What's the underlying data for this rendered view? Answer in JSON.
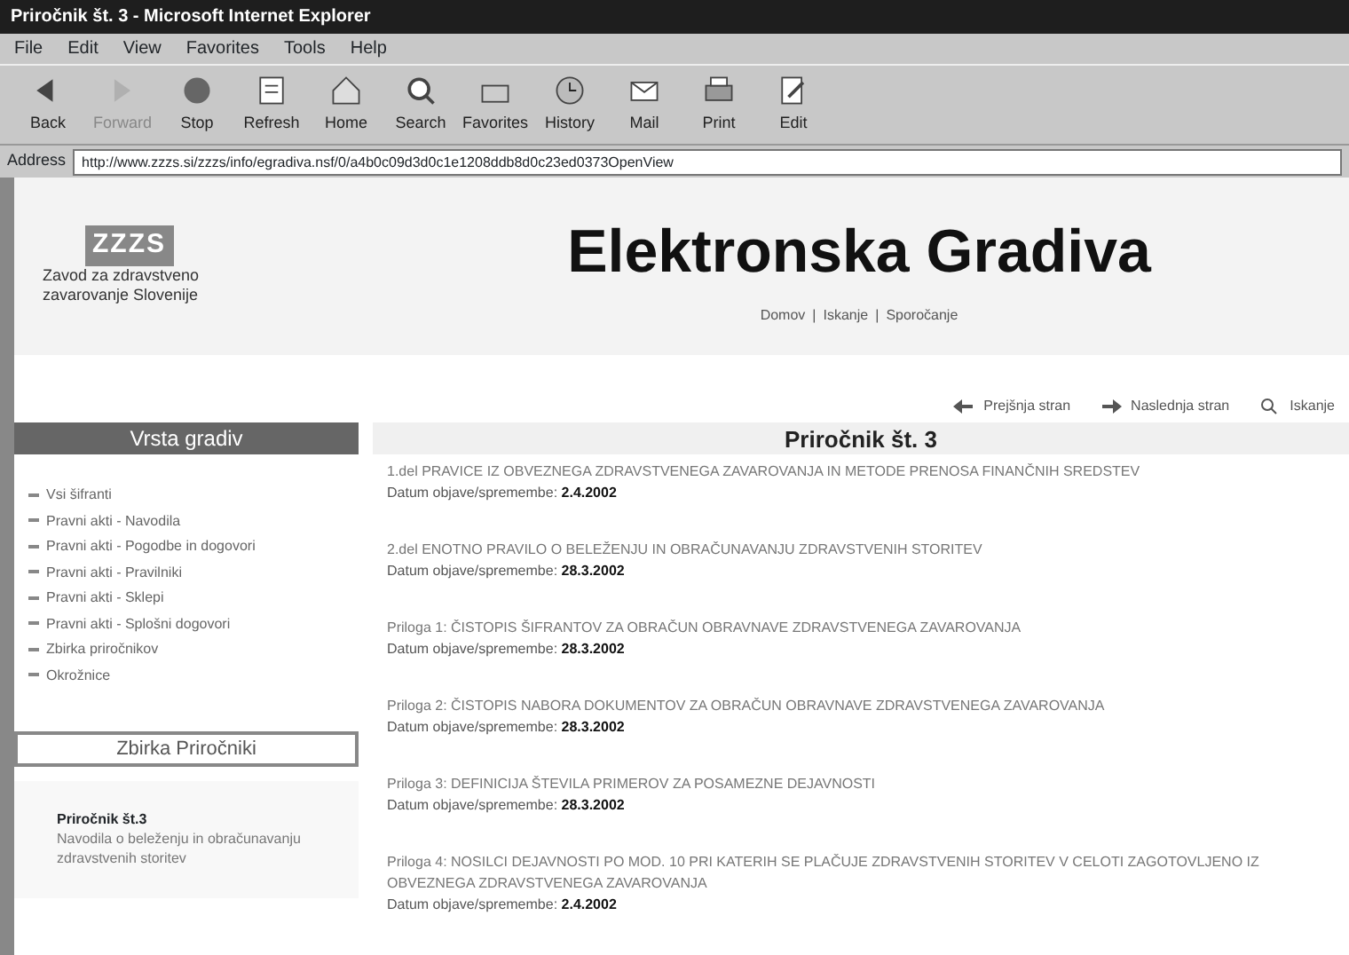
{
  "window": {
    "title": "Priročnik št. 3 - Microsoft Internet Explorer"
  },
  "menu": [
    "File",
    "Edit",
    "View",
    "Favorites",
    "Tools",
    "Help"
  ],
  "toolbar": [
    {
      "label": "Back",
      "kind": "back",
      "disabled": false
    },
    {
      "label": "Forward",
      "kind": "forward",
      "disabled": true
    },
    {
      "label": "Stop",
      "kind": "stop",
      "disabled": false
    },
    {
      "label": "Refresh",
      "kind": "refresh",
      "disabled": false
    },
    {
      "label": "Home",
      "kind": "home",
      "disabled": false
    },
    {
      "label": "Search",
      "kind": "search",
      "disabled": false
    },
    {
      "label": "Favorites",
      "kind": "favorites",
      "disabled": false
    },
    {
      "label": "History",
      "kind": "history",
      "disabled": false
    },
    {
      "label": "Mail",
      "kind": "mail",
      "disabled": false
    },
    {
      "label": "Print",
      "kind": "print",
      "disabled": false
    },
    {
      "label": "Edit",
      "kind": "edit",
      "disabled": false
    }
  ],
  "address": {
    "label": "Address",
    "value": "http://www.zzzs.si/zzzs/info/egradiva.nsf/0/a4b0c09d3d0c1e1208ddb8d0c23ed0373OpenView"
  },
  "header": {
    "logo": "ZZZS",
    "org_lines": [
      "Zavod za zdravstveno",
      "zavarovanje Slovenije"
    ],
    "title": "Elektronska Gradiva",
    "links": [
      "Domov",
      "Iskanje",
      "Sporočanje"
    ],
    "separators": [
      "|",
      "|"
    ]
  },
  "nav_links": [
    {
      "label": "Prejšnja stran",
      "kind": "prev"
    },
    {
      "label": "Naslednja stran",
      "kind": "next"
    },
    {
      "label": "Iskanje",
      "kind": "search"
    }
  ],
  "sidebar": {
    "heading": "Vrsta gradiv",
    "items": [
      "Vsi šifranti",
      "Pravni akti - Navodila",
      "Pravni akti - Pogodbe in dogovori",
      "Pravni akti - Pravilniki",
      "Pravni akti - Sklepi",
      "Pravni akti - Splošni dogovori",
      "Zbirka priročnikov",
      "Okrožnice"
    ],
    "box_heading": "Zbirka Priročniki",
    "current": {
      "title": "Priročnik št.3",
      "text": "Navodila o beleženju in obračunavanju zdravstvenih storitev"
    }
  },
  "main": {
    "heading": "Priročnik št. 3",
    "documents": [
      {
        "title": "1.del PRAVICE IZ OBVEZNEGA ZDRAVSTVENEGA ZAVAROVANJA IN METODE PRENOSA FINANČNIH SREDSTEV",
        "date_label": "Datum objave/spremembe:",
        "date": "2.4.2002"
      },
      {
        "title": "2.del ENOTNO PRAVILO O BELEŽENJU IN OBRAČUNAVANJU ZDRAVSTVENIH STORITEV",
        "date_label": "Datum objave/spremembe:",
        "date": "28.3.2002"
      },
      {
        "title": "Priloga 1: ČISTOPIS ŠIFRANTOV ZA OBRAČUN OBRAVNAVE ZDRAVSTVENEGA ZAVAROVANJA",
        "date_label": "Datum objave/spremembe:",
        "date": "28.3.2002"
      },
      {
        "title": "Priloga 2: ČISTOPIS NABORA DOKUMENTOV ZA OBRAČUN OBRAVNAVE ZDRAVSTVENEGA ZAVAROVANJA",
        "date_label": "Datum objave/spremembe:",
        "date": "28.3.2002"
      },
      {
        "title": "Priloga 3: DEFINICIJA ŠTEVILA PRIMEROV ZA POSAMEZNE DEJAVNOSTI",
        "date_label": "Datum objave/spremembe:",
        "date": "28.3.2002"
      },
      {
        "title": "Priloga 4: NOSILCI DEJAVNOSTI PO MOD. 10 PRI KATERIH SE PLAČUJE ZDRAVSTVENIH STORITEV V CELOTI ZAGOTOVLJENO IZ OBVEZNEGA ZDRAVSTVENEGA ZAVAROVANJA",
        "date_label": "Datum objave/spremembe:",
        "date": "2.4.2002"
      }
    ]
  }
}
